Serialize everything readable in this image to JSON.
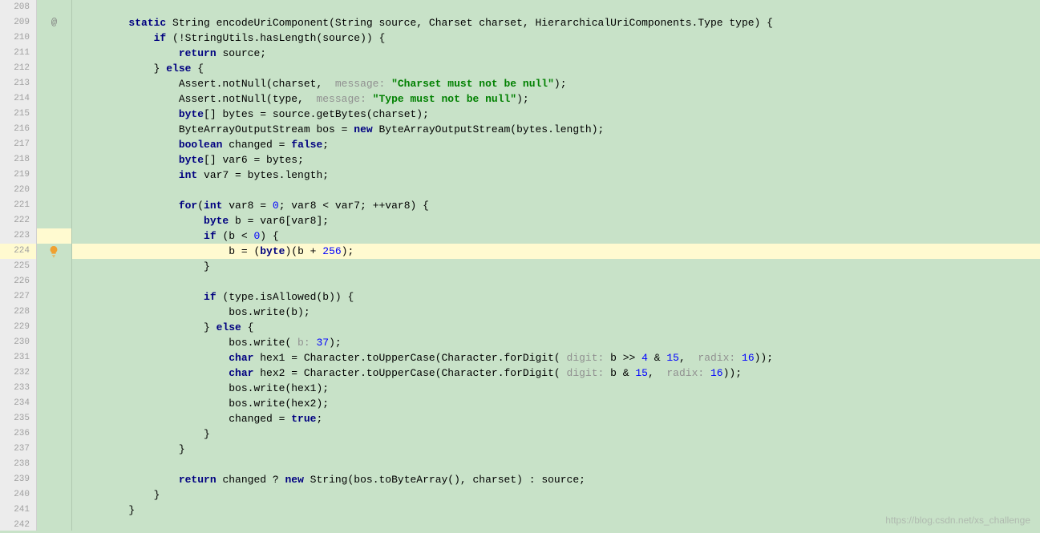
{
  "lineStart": 208,
  "lineEnd": 242,
  "highlightedLine": 224,
  "gutterMarkLine": 209,
  "gutterMarkSymbol": "@",
  "bulbLine": 224,
  "watermark": "https://blog.csdn.net/xs_challenge",
  "code": {
    "l208": "",
    "l209_1": "static",
    "l209_2": " String encodeUriComponent(String source, Charset charset, HierarchicalUriComponents.Type type) {",
    "l210_1": "if",
    "l210_2": " (!StringUtils.hasLength(source)) {",
    "l211_1": "return",
    "l211_2": " source;",
    "l212_1": "} ",
    "l212_2": "else",
    "l212_3": " {",
    "l213_1": "Assert.notNull(charset, ",
    "l213_h": " message: ",
    "l213_s": "\"Charset must not be null\"",
    "l213_2": ");",
    "l214_1": "Assert.notNull(type, ",
    "l214_h": " message: ",
    "l214_s": "\"Type must not be null\"",
    "l214_2": ");",
    "l215_1": "byte",
    "l215_2": "[] bytes = source.getBytes(charset);",
    "l216_1": "ByteArrayOutputStream bos = ",
    "l216_2": "new",
    "l216_3": " ByteArrayOutputStream(bytes.length);",
    "l217_1": "boolean",
    "l217_2": " changed = ",
    "l217_3": "false",
    "l217_4": ";",
    "l218_1": "byte",
    "l218_2": "[] var6 = bytes;",
    "l219_1": "int",
    "l219_2": " var7 = bytes.length;",
    "l220": "",
    "l221_1": "for",
    "l221_2": "(",
    "l221_3": "int",
    "l221_4": " var8 = ",
    "l221_n1": "0",
    "l221_5": "; var8 < var7; ++var8) {",
    "l222_1": "byte",
    "l222_2": " b = var6[var8];",
    "l223_1": "if",
    "l223_2": " (b < ",
    "l223_n": "0",
    "l223_3": ") {",
    "l224_1": "b = (",
    "l224_2": "byte",
    "l224_3": ")(b + ",
    "l224_n": "256",
    "l224_4": ");",
    "l225": "}",
    "l226": "",
    "l227_1": "if",
    "l227_2": " (type.isAllowed(b)) {",
    "l228": "bos.write(b);",
    "l229_1": "} ",
    "l229_2": "else",
    "l229_3": " {",
    "l230_1": "bos.write(",
    "l230_h": " b: ",
    "l230_n": "37",
    "l230_2": ");",
    "l231_1": "char",
    "l231_2": " hex1 = Character.toUpperCase(Character.forDigit(",
    "l231_h1": " digit: ",
    "l231_3": "b >> ",
    "l231_n1": "4",
    "l231_4": " & ",
    "l231_n2": "15",
    "l231_5": ", ",
    "l231_h2": " radix: ",
    "l231_n3": "16",
    "l231_6": "));",
    "l232_1": "char",
    "l232_2": " hex2 = Character.toUpperCase(Character.forDigit(",
    "l232_h1": " digit: ",
    "l232_3": "b & ",
    "l232_n1": "15",
    "l232_4": ", ",
    "l232_h2": " radix: ",
    "l232_n2": "16",
    "l232_5": "));",
    "l233": "bos.write(hex1);",
    "l234": "bos.write(hex2);",
    "l235_1": "changed = ",
    "l235_2": "true",
    "l235_3": ";",
    "l236": "}",
    "l237": "}",
    "l238": "",
    "l239_1": "return",
    "l239_2": " changed ? ",
    "l239_3": "new",
    "l239_4": " String(bos.toByteArray(), charset) : source;",
    "l240": "}",
    "l241": "}",
    "l242": ""
  },
  "indents": {
    "l209": "        ",
    "l210": "            ",
    "l211": "                ",
    "l212": "            ",
    "l213": "                ",
    "l214": "                ",
    "l215": "                ",
    "l216": "                ",
    "l217": "                ",
    "l218": "                ",
    "l219": "                ",
    "l221": "                ",
    "l222": "                    ",
    "l223": "                    ",
    "l224": "                        ",
    "l225": "                    ",
    "l227": "                    ",
    "l228": "                        ",
    "l229": "                    ",
    "l230": "                        ",
    "l231": "                        ",
    "l232": "                        ",
    "l233": "                        ",
    "l234": "                        ",
    "l235": "                        ",
    "l236": "                    ",
    "l237": "                ",
    "l239": "                ",
    "l240": "            ",
    "l241": "        "
  }
}
